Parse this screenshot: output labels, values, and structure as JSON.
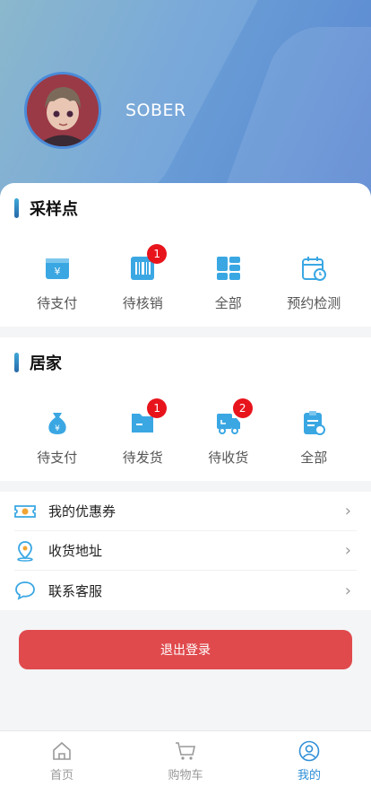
{
  "profile": {
    "username": "SOBER"
  },
  "sampling": {
    "title": "采样点",
    "items": [
      {
        "label": "待支付",
        "icon": "wallet-icon",
        "badge": ""
      },
      {
        "label": "待核销",
        "icon": "barcode-icon",
        "badge": "1"
      },
      {
        "label": "全部",
        "icon": "grid-icon",
        "badge": ""
      },
      {
        "label": "预约检测",
        "icon": "calendar-icon",
        "badge": ""
      }
    ]
  },
  "home": {
    "title": "居家",
    "items": [
      {
        "label": "待支付",
        "icon": "money-bag-icon",
        "badge": ""
      },
      {
        "label": "待发货",
        "icon": "box-icon",
        "badge": "1"
      },
      {
        "label": "待收货",
        "icon": "truck-icon",
        "badge": "2"
      },
      {
        "label": "全部",
        "icon": "clipboard-icon",
        "badge": ""
      }
    ]
  },
  "menu": [
    {
      "label": "我的优惠券",
      "icon": "coupon-icon"
    },
    {
      "label": "收货地址",
      "icon": "location-icon"
    },
    {
      "label": "联系客服",
      "icon": "chat-icon"
    }
  ],
  "logout_label": "退出登录",
  "tabs": [
    {
      "label": "首页",
      "icon": "home-icon",
      "active": false
    },
    {
      "label": "购物车",
      "icon": "cart-icon",
      "active": false
    },
    {
      "label": "我的",
      "icon": "user-icon",
      "active": true
    }
  ],
  "colors": {
    "accent": "#2f8fd8",
    "icon_blue": "#3aa7e3",
    "badge": "#e8141c",
    "logout": "#e04a4d"
  }
}
